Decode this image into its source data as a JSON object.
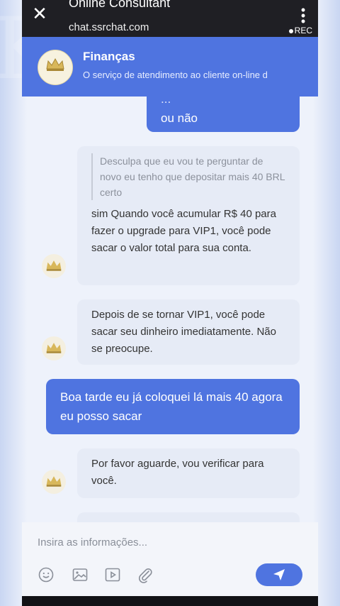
{
  "browser": {
    "title": "Online Consultant",
    "url": "chat.ssrchat.com",
    "rec_label": "REC",
    "close_symbol": "✕",
    "menu_symbol": "⋮"
  },
  "chat_header": {
    "name": "Finanças",
    "subtitle": "O serviço de atendimento ao cliente on-line d"
  },
  "messages": [
    {
      "side": "out",
      "text_line1": "...",
      "text_line2": "ou não"
    },
    {
      "side": "in",
      "quote": "Desculpa que eu vou te perguntar de novo eu tenho que depositar mais 40 BRL certo",
      "text": "sim Quando você acumular R$ 40 para fazer o upgrade para VIP1, você pode sacar o valor total para sua conta."
    },
    {
      "side": "in",
      "text": "Depois de se tornar VIP1, você pode sacar seu dinheiro imediatamente. Não se preocupe."
    },
    {
      "side": "out",
      "text": "Boa tarde eu já coloquei lá mais 40 agora eu posso sacar"
    },
    {
      "side": "in",
      "text": "Por favor aguarde, vou verificar para você."
    }
  ],
  "input": {
    "placeholder": "Insira as informações..."
  },
  "toolbar_icons": [
    "emoji-icon",
    "image-icon",
    "video-icon",
    "attachment-icon"
  ],
  "colors": {
    "accent": "#4f74e0",
    "topbar": "#1f1f24",
    "incoming_bubble": "#e6ebf6"
  }
}
